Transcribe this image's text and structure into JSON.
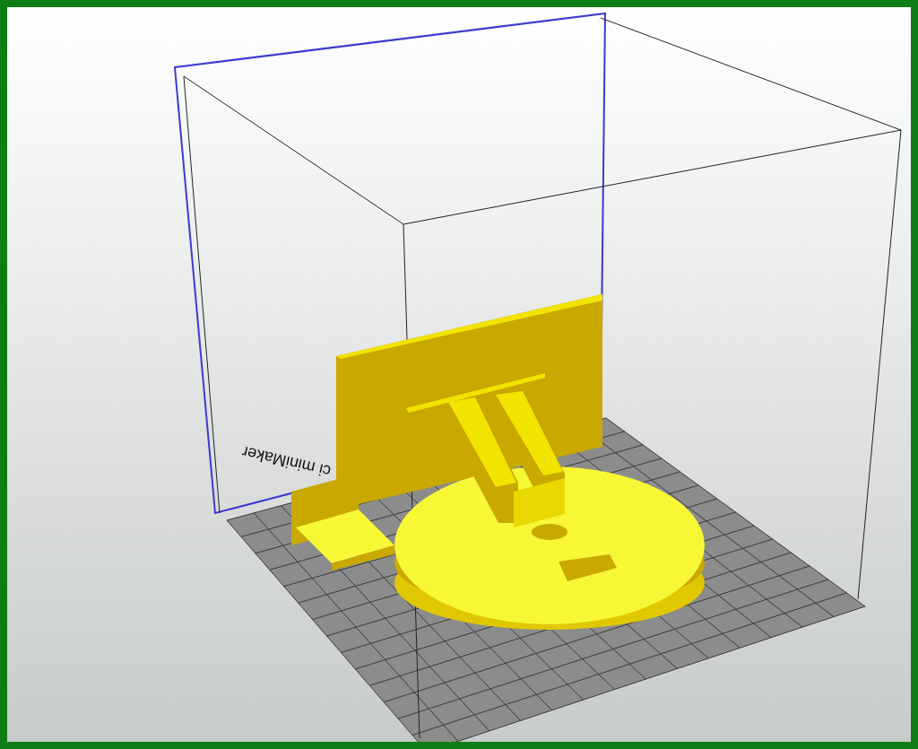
{
  "viewport": {
    "plate_label": "ci miniMaker"
  }
}
